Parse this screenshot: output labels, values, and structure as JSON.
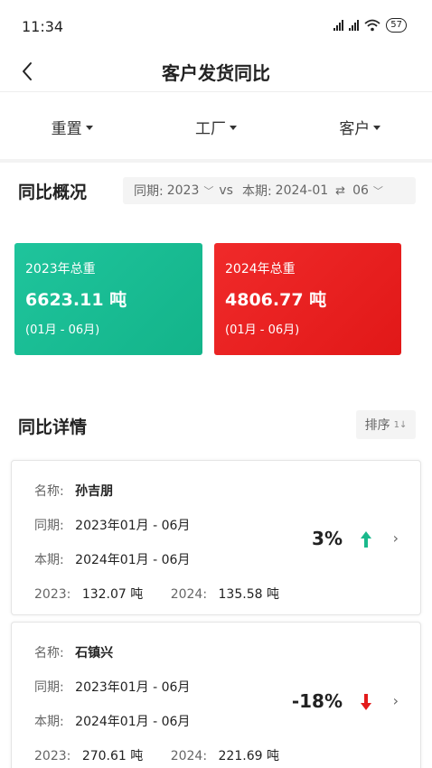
{
  "status": {
    "time": "11:34",
    "battery": "57"
  },
  "nav": {
    "title": "客户发货同比"
  },
  "filters": [
    "重置",
    "工厂",
    "客户"
  ],
  "overview": {
    "title": "同比概况",
    "prev_label": "同期:",
    "prev_year": "2023",
    "vs": "vs",
    "curr_label": "本期:",
    "curr_start": "2024-01",
    "curr_end": "06"
  },
  "cards": [
    {
      "label": "2023年总重",
      "value": "6623.11 吨",
      "range": "(01月 - 06月)",
      "color": "#1cc096"
    },
    {
      "label": "2024年总重",
      "value": "4806.77 吨",
      "range": "(01月 - 06月)",
      "color": "#ea2020"
    }
  ],
  "detail": {
    "title": "同比详情",
    "sort_label": "排序",
    "sort_icon": "1↓"
  },
  "records": [
    {
      "name_label": "名称:",
      "name": "孙吉朋",
      "prev_label": "同期:",
      "prev": "2023年01月 - 06月",
      "curr_label": "本期:",
      "curr": "2024年01月 - 06月",
      "y1_label": "2023:",
      "y1": "132.07 吨",
      "y2_label": "2024:",
      "y2": "135.58 吨",
      "pct": "3%",
      "trend": "up",
      "trend_color": "#1ab98c"
    },
    {
      "name_label": "名称:",
      "name": "石镇兴",
      "prev_label": "同期:",
      "prev": "2023年01月 - 06月",
      "curr_label": "本期:",
      "curr": "2024年01月 - 06月",
      "y1_label": "2023:",
      "y1": "270.61 吨",
      "y2_label": "2024:",
      "y2": "221.69 吨",
      "pct": "-18%",
      "trend": "down",
      "trend_color": "#e31b1b"
    }
  ]
}
